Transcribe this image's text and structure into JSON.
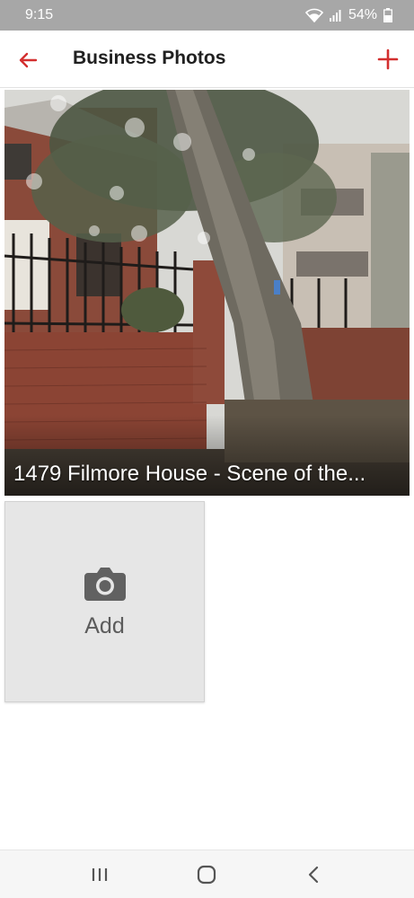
{
  "status_bar": {
    "time": "9:15",
    "battery": "54%",
    "icons": [
      "wifi-icon",
      "signal-icon",
      "battery-icon"
    ]
  },
  "app_bar": {
    "title": "Business Photos",
    "back_icon": "arrow-left-icon",
    "add_icon": "plus-icon",
    "accent_color": "#d32f2f"
  },
  "photos": [
    {
      "caption": "1479 Filmore House - Scene of the..."
    }
  ],
  "add_tile": {
    "label": "Add",
    "icon": "camera-icon"
  },
  "nav_bar": {
    "icons": [
      "recent-apps-icon",
      "home-icon",
      "back-icon"
    ]
  }
}
